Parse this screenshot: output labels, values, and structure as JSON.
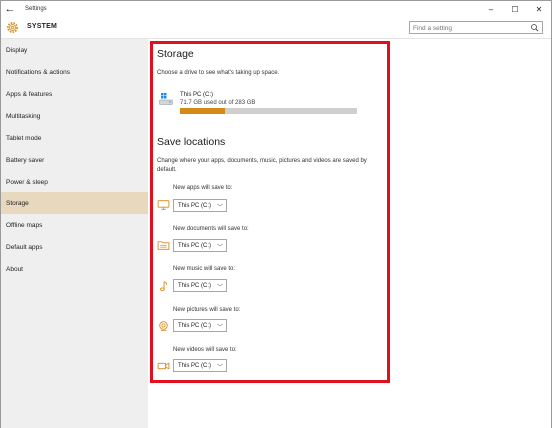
{
  "window": {
    "title": "Settings",
    "controls": {
      "minimize": "–",
      "maximize": "☐",
      "close": "✕"
    },
    "back_glyph": "←"
  },
  "header": {
    "section": "SYSTEM",
    "search_placeholder": "Find a setting"
  },
  "sidebar": {
    "items": [
      {
        "label": "Display"
      },
      {
        "label": "Notifications & actions"
      },
      {
        "label": "Apps & features"
      },
      {
        "label": "Multitasking"
      },
      {
        "label": "Tablet mode"
      },
      {
        "label": "Battery saver"
      },
      {
        "label": "Power & sleep"
      },
      {
        "label": "Storage",
        "active": true
      },
      {
        "label": "Offline maps"
      },
      {
        "label": "Default apps"
      },
      {
        "label": "About"
      }
    ]
  },
  "storage": {
    "heading": "Storage",
    "description": "Choose a drive to see what's taking up space.",
    "drive": {
      "name": "This PC (C:)",
      "usage_text": "71.7 GB used out of 283 GB",
      "used_gb": 71.7,
      "total_gb": 283
    }
  },
  "save_locations": {
    "heading": "Save locations",
    "description": "Change where your apps, documents, music, pictures and videos are saved by default.",
    "items": [
      {
        "label": "New apps will save to:",
        "value": "This PC (C:)",
        "icon": "monitor-icon"
      },
      {
        "label": "New documents will save to:",
        "value": "This PC (C:)",
        "icon": "documents-folder-icon"
      },
      {
        "label": "New music will save to:",
        "value": "This PC (C:)",
        "icon": "music-note-icon"
      },
      {
        "label": "New pictures will save to:",
        "value": "This PC (C:)",
        "icon": "camera-icon"
      },
      {
        "label": "New videos will save to:",
        "value": "This PC (C:)",
        "icon": "video-camera-icon"
      }
    ]
  },
  "colors": {
    "accent": "#d48a17",
    "sidebar_active": "#e8d8bd",
    "highlight_border": "#e0101e"
  }
}
